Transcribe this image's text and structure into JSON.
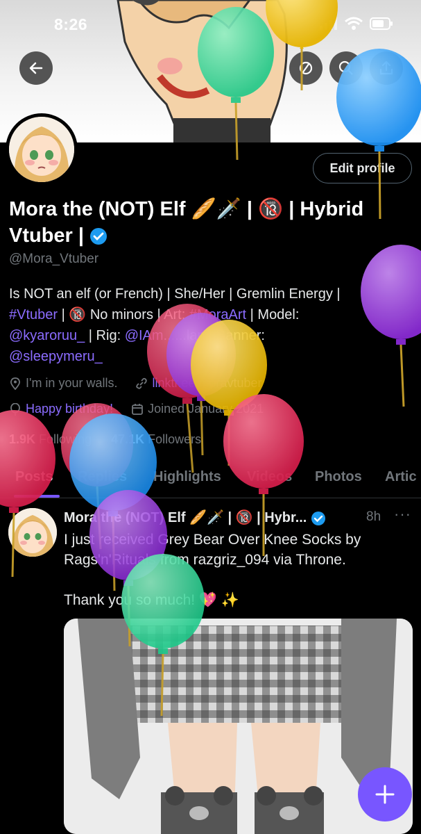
{
  "status_bar": {
    "time": "8:26"
  },
  "header": {
    "back_icon": "arrow-left-icon",
    "more_icons": [
      "search-icon",
      "share-icon"
    ]
  },
  "profile": {
    "edit_label": "Edit profile",
    "name_line1": "Mora the (NOT) Elf 🥖🗡️ | 🔞 | Hybrid",
    "name_line2": "Vtuber |",
    "handle": "@Mora_Vtuber",
    "bio_line1": "Is NOT an elf (or French) | She/Her | Gremlin Energy |",
    "bio_tag_vtuber": "#Vtuber",
    "bio_line2_mid": " | 🔞 No minors | Art: ",
    "bio_tag_art": "#MoraArt",
    "bio_line2_end": " | Model:",
    "bio_kyaro": "@kyaroruu_",
    "bio_line3_mid": " | Rig: ",
    "bio_rig": "@IAm...",
    "bio_line3_end": "...lan | Banner:",
    "bio_banner": "@sleepymeru_",
    "location": "I'm in your walls.",
    "link": "linktr.ee/moravtuber",
    "birthday": "Happy birthday!",
    "joined": "Joined January 2021",
    "following_count": "1.9K",
    "following_label": " Following",
    "followers_count": "47.1K",
    "followers_label": " Followers"
  },
  "tabs": [
    "Posts",
    "Replies",
    "Highlights",
    "Videos",
    "Photos",
    "Artic"
  ],
  "post": {
    "name": "Mora the (NOT) Elf 🥖🗡️ | 🔞 | Hybr...",
    "time": "8h",
    "more": "···",
    "text": "I just received Grey Bear Over Knee Socks by Rags'n'Rituals from razgriz_094 via Throne.\n\nThank you so much! 💖 ✨"
  },
  "fab_icon": "plus-icon",
  "colors": {
    "accent": "#7856ff",
    "background": "#000000",
    "muted": "#71767b",
    "link": "#8b6cff"
  }
}
